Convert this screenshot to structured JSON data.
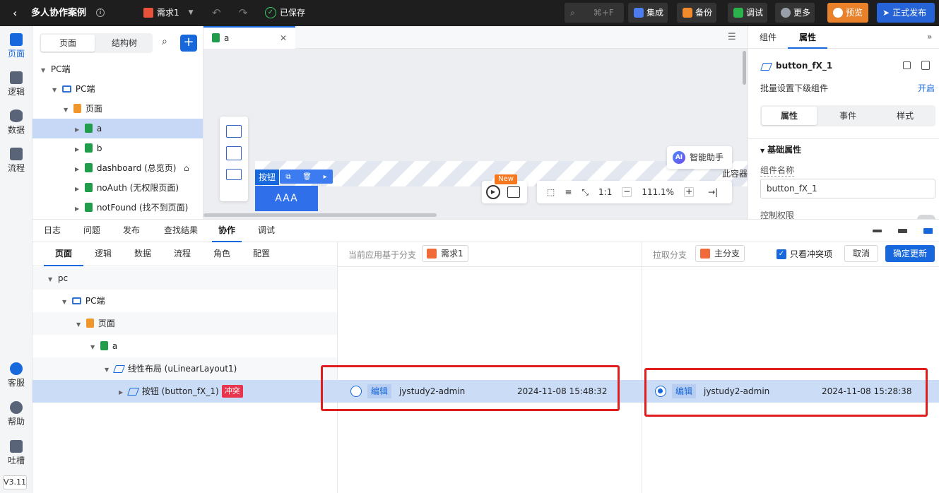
{
  "topbar": {
    "back_icon": "chevron-left-icon",
    "app_title": "多人协作案例",
    "branch_name": "需求1",
    "saved_text": "已保存",
    "search_shortcut": "⌘+F",
    "integrate_label": "集成",
    "backup_label": "备份",
    "debug_label": "调试",
    "more_label": "更多",
    "preview_label": "预览",
    "publish_label": "正式发布",
    "colors": {
      "preview": "#e8812a",
      "publish": "#2563d6"
    }
  },
  "rail": {
    "items": [
      {
        "label": "页面",
        "icon": "page-icon"
      },
      {
        "label": "逻辑",
        "icon": "logic-icon"
      },
      {
        "label": "数据",
        "icon": "database-icon"
      },
      {
        "label": "流程",
        "icon": "flow-icon"
      }
    ],
    "bottom_items": [
      {
        "label": "客服",
        "icon": "headset-icon"
      },
      {
        "label": "帮助",
        "icon": "help-icon"
      },
      {
        "label": "吐槽",
        "icon": "feedback-icon"
      }
    ],
    "version": "V3.11"
  },
  "tree": {
    "tabs": [
      "页面",
      "结构树"
    ],
    "rows": [
      {
        "label": "PC端"
      },
      {
        "label": "PC端"
      },
      {
        "label": "页面"
      },
      {
        "label": "a"
      },
      {
        "label": "b"
      },
      {
        "label": "dashboard (总览页)"
      },
      {
        "label": "noAuth (无权限页面)"
      },
      {
        "label": "notFound (找不到页面)"
      }
    ]
  },
  "canvas": {
    "tab_name": "a",
    "button_label": "按钮",
    "aaa_text": "AAA",
    "ai_assistant": "智能助手",
    "container_text": "此容器",
    "new_badge": "New",
    "ratio": "1:1",
    "zoom": "111.1%"
  },
  "props": {
    "tabs": [
      "组件",
      "属性"
    ],
    "component_name": "button_fX_1",
    "batch_label": "批量设置下级组件",
    "batch_action": "开启",
    "sub_tabs": [
      "属性",
      "事件",
      "样式"
    ],
    "section_title": "基础属性",
    "name_label": "组件名称",
    "name_value": "button_fX_1",
    "permission_label": "控制权限"
  },
  "bottom": {
    "tabs": [
      "日志",
      "问题",
      "发布",
      "查找结果",
      "协作",
      "调试"
    ],
    "sub_tabs": [
      "页面",
      "逻辑",
      "数据",
      "流程",
      "角色",
      "配置"
    ],
    "current_base_label": "当前应用基于分支",
    "current_branch": "需求1",
    "pull_label": "拉取分支",
    "pull_branch": "主分支",
    "only_conflict": "只看冲突项",
    "cancel": "取消",
    "confirm": "确定更新",
    "tree": [
      {
        "label": "pc"
      },
      {
        "label": "PC端"
      },
      {
        "label": "页面"
      },
      {
        "label": "a"
      },
      {
        "label": "线性布局 (uLinearLayout1)"
      },
      {
        "label": "按钮 (button_fX_1)",
        "badge": "冲突"
      }
    ],
    "left_change": {
      "tag": "编辑",
      "user": "jystudy2-admin",
      "time": "2024-11-08 15:48:32"
    },
    "right_change": {
      "tag": "编辑",
      "user": "jystudy2-admin",
      "time": "2024-11-08 15:28:38"
    }
  }
}
